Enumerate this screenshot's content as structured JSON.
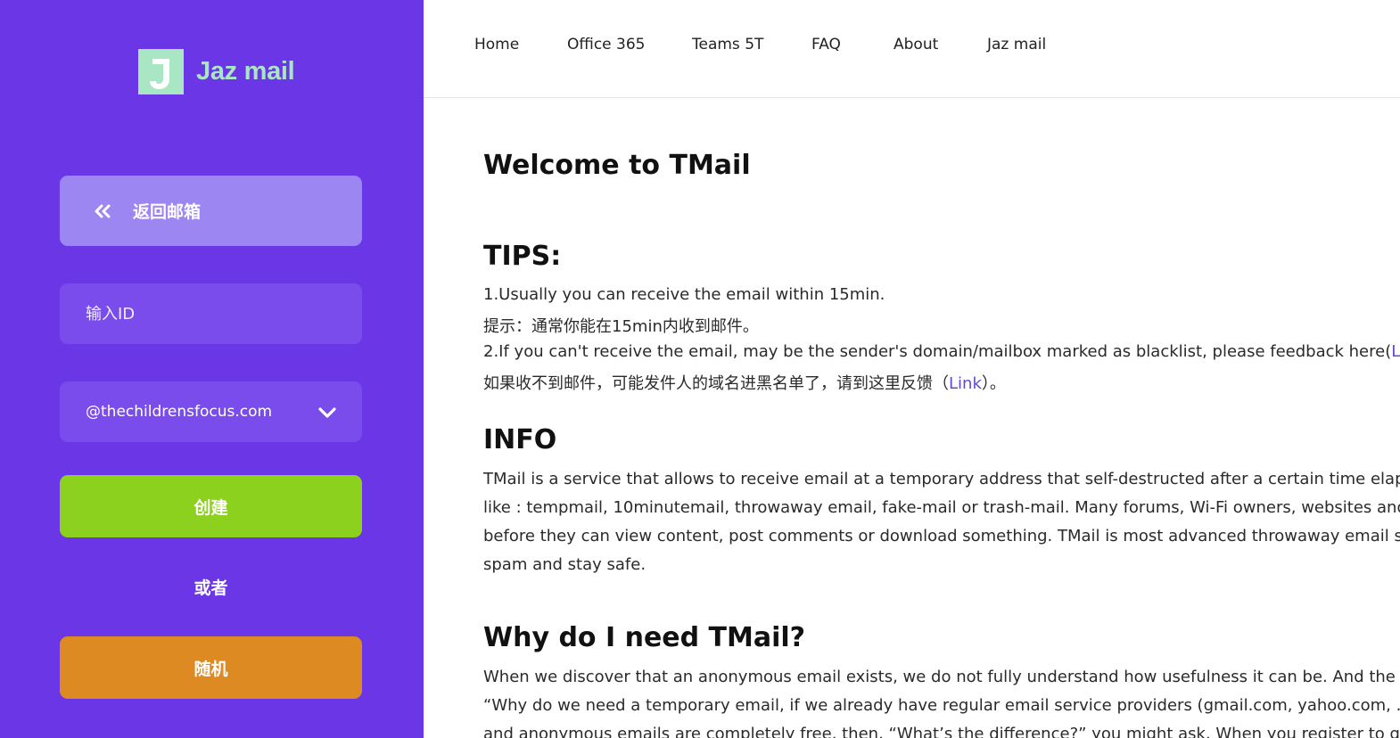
{
  "brand": {
    "name": "Jaz mail",
    "accent": "#a8e6c4",
    "sidebar_bg": "#6a36e6"
  },
  "sidebar": {
    "back_label": "返回邮箱",
    "id_placeholder": "输入ID",
    "domain_value": "@thechildrensfocus.com",
    "create_label": "创建",
    "or_label": "或者",
    "random_label": "随机"
  },
  "nav": {
    "items": [
      "Home",
      "Office 365",
      "Teams 5T",
      "FAQ",
      "About",
      "Jaz mail"
    ]
  },
  "main": {
    "welcome": "Welcome to TMail",
    "tips": {
      "heading": "TIPS:",
      "line1": "1.Usually you can receive the email within 15min.",
      "line2": "提示：通常你能在15min内收到邮件。",
      "line3_prefix": "2.If you can't receive the email, may be the sender's domain/mailbox marked as blacklist, please feedback here(",
      "line3_link": "Link",
      "line4_prefix": "如果收不到邮件，可能发件人的域名进黑名单了，请到这里反馈（",
      "line4_link": "Link",
      "line4_suffix": "）。"
    },
    "info": {
      "heading": "INFO",
      "lines": [
        "TMail is a service that allows to receive email at a temporary address that self-destructed after a certain time elaps",
        "like : tempmail, 10minutemail, throwaway email, fake-mail or trash-mail. Many forums, Wi-Fi owners, websites and",
        "before they can view content, post comments or download something. TMail is most advanced throwaway email se",
        "spam and stay safe."
      ]
    },
    "why": {
      "heading": "Why do I need TMail?",
      "lines": [
        "When we discover that an anonymous email exists, we do not fully understand how usefulness it can be. And the r",
        "“Why do we need a temporary email, if we already have regular email service providers (gmail.com, yahoo.com, ...)?",
        "and anonymous emails are completely free, then, “What’s the difference?” you might ask. When you register to get"
      ]
    }
  }
}
